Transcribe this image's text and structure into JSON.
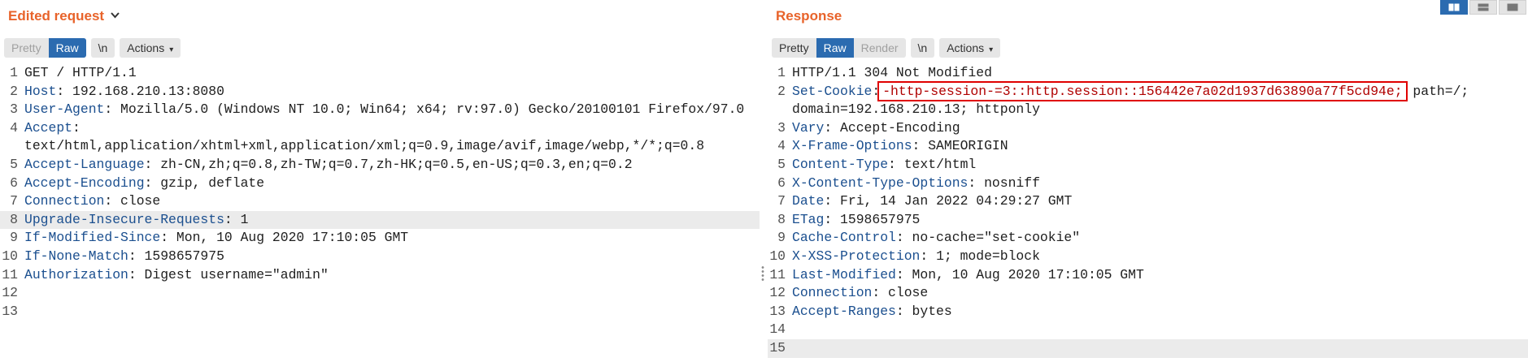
{
  "request": {
    "title": "Edited request",
    "buttons": {
      "pretty": "Pretty",
      "raw": "Raw",
      "newline": "\\n",
      "actions": "Actions"
    },
    "lines": [
      {
        "n": "1",
        "key": "",
        "rest": "GET / HTTP/1.1"
      },
      {
        "n": "2",
        "key": "Host",
        "rest": ": 192.168.210.13:8080"
      },
      {
        "n": "3",
        "key": "User-Agent",
        "rest": ": Mozilla/5.0 (Windows NT 10.0; Win64; x64; rv:97.0) Gecko/20100101 Firefox/97.0"
      },
      {
        "n": "4",
        "key": "Accept",
        "rest": ":"
      },
      {
        "n": "",
        "key": "",
        "rest": "text/html,application/xhtml+xml,application/xml;q=0.9,image/avif,image/webp,*/*;q=0.8"
      },
      {
        "n": "5",
        "key": "Accept-Language",
        "rest": ": zh-CN,zh;q=0.8,zh-TW;q=0.7,zh-HK;q=0.5,en-US;q=0.3,en;q=0.2"
      },
      {
        "n": "6",
        "key": "Accept-Encoding",
        "rest": ": gzip, deflate"
      },
      {
        "n": "7",
        "key": "Connection",
        "rest": ": close"
      },
      {
        "n": "8",
        "key": "Upgrade-Insecure-Requests",
        "rest": ": 1"
      },
      {
        "n": "9",
        "key": "If-Modified-Since",
        "rest": ": Mon, 10 Aug 2020 17:10:05 GMT"
      },
      {
        "n": "10",
        "key": "If-None-Match",
        "rest": ": 1598657975"
      },
      {
        "n": "11",
        "key": "Authorization",
        "rest": ": Digest username=\"admin\""
      },
      {
        "n": "12",
        "key": "",
        "rest": ""
      },
      {
        "n": "13",
        "key": "",
        "rest": ""
      }
    ]
  },
  "response": {
    "title": "Response",
    "buttons": {
      "pretty": "Pretty",
      "raw": "Raw",
      "render": "Render",
      "newline": "\\n",
      "actions": "Actions"
    },
    "lines": [
      {
        "n": "1",
        "key": "",
        "rest": "HTTP/1.1 304 Not Modified"
      },
      {
        "n": "2",
        "key": "Set-Cookie",
        "rest": ":",
        "boxed": "-http-session-=3::http.session::156442e7a02d1937d63890a77f5cd94e;",
        "after": " path=/;"
      },
      {
        "n": "",
        "key": "",
        "rest": "domain=192.168.210.13; httponly"
      },
      {
        "n": "3",
        "key": "Vary",
        "rest": ": Accept-Encoding"
      },
      {
        "n": "4",
        "key": "X-Frame-Options",
        "rest": ": SAMEORIGIN"
      },
      {
        "n": "5",
        "key": "Content-Type",
        "rest": ": text/html"
      },
      {
        "n": "6",
        "key": "X-Content-Type-Options",
        "rest": ": nosniff"
      },
      {
        "n": "7",
        "key": "Date",
        "rest": ": Fri, 14 Jan 2022 04:29:27 GMT"
      },
      {
        "n": "8",
        "key": "ETag",
        "rest": ": 1598657975"
      },
      {
        "n": "9",
        "key": "Cache-Control",
        "rest": ": no-cache=\"set-cookie\""
      },
      {
        "n": "10",
        "key": "X-XSS-Protection",
        "rest": ": 1; mode=block"
      },
      {
        "n": "11",
        "key": "Last-Modified",
        "rest": ": Mon, 10 Aug 2020 17:10:05 GMT"
      },
      {
        "n": "12",
        "key": "Connection",
        "rest": ": close"
      },
      {
        "n": "13",
        "key": "Accept-Ranges",
        "rest": ": bytes"
      },
      {
        "n": "14",
        "key": "",
        "rest": ""
      },
      {
        "n": "15",
        "key": "",
        "rest": ""
      }
    ]
  },
  "colors": {
    "title": "#e8632a",
    "active": "#2b6bb0",
    "header_key": "#1b4f8f",
    "highlight_box": "#e00000"
  },
  "icons": {
    "view_layout": [
      "split-columns-icon",
      "split-rows-icon",
      "single-pane-icon"
    ],
    "title_dropdown": "chevron-down-icon",
    "divider": "drag-handle-icon"
  }
}
